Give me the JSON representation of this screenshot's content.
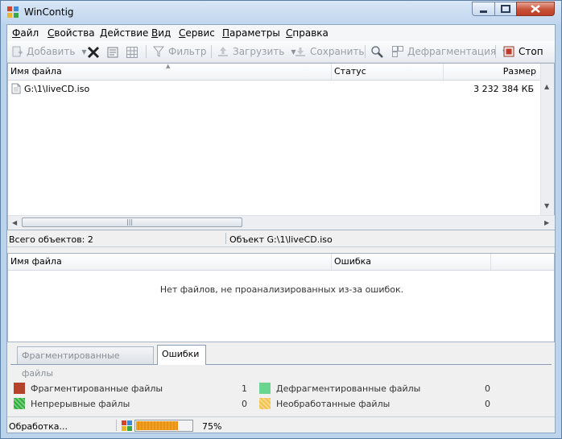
{
  "window": {
    "title": "WinContig"
  },
  "menu": {
    "items": [
      {
        "label": "Файл",
        "u": "Ф",
        "rest": "айл"
      },
      {
        "label": "Свойства",
        "u": "С",
        "rest": "войства"
      },
      {
        "label": "Действие",
        "u": "Д",
        "rest": "ействие"
      },
      {
        "label": "Вид",
        "u": "В",
        "rest": "ид"
      },
      {
        "label": "Сервис",
        "u": "С",
        "rest": "ервис"
      },
      {
        "label": "Параметры",
        "u": "П",
        "rest": "араметры"
      },
      {
        "label": "Справка",
        "u": "С",
        "rest": "правка"
      }
    ]
  },
  "toolbar": {
    "add": "Добавить",
    "filter": "Фильтр",
    "load": "Загрузить",
    "save": "Сохранить",
    "defrag": "Дефрагментация",
    "stop": "Стоп"
  },
  "files": {
    "columns": {
      "name": "Имя файла",
      "status": "Статус",
      "size": "Размер"
    },
    "rows": [
      {
        "name": "G:\\1\\liveCD.iso",
        "status": "",
        "size": "3 232 384 КБ"
      }
    ]
  },
  "status_row": {
    "total": "Всего объектов: 2",
    "object": "Объект G:\\1\\liveCD.iso"
  },
  "errors": {
    "columns": {
      "name": "Имя файла",
      "error": "Ошибка"
    },
    "empty_message": "Нет файлов, не проанализированных из-за ошибок."
  },
  "tabs": {
    "fragmented": "Фрагментированные файлы",
    "errors": "Ошибки"
  },
  "legend": {
    "fragmented": {
      "label": "Фрагментированные файлы",
      "count": "1",
      "color": "#b5432b"
    },
    "contiguous": {
      "label": "Непрерывные файлы",
      "count": "0",
      "color": "#2eae3a"
    },
    "defragmented": {
      "label": "Дефрагментированные файлы",
      "count": "0",
      "color": "#6ad58e"
    },
    "unprocessed": {
      "label": "Необработанные файлы",
      "count": "0",
      "color": "#f2c24a"
    }
  },
  "statusbar": {
    "processing": "Обработка...",
    "percent_text": "75%",
    "progress": 0.75
  }
}
